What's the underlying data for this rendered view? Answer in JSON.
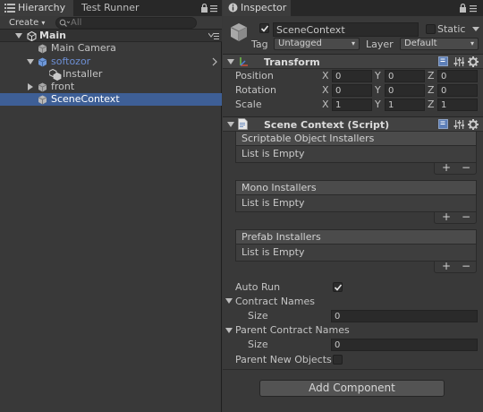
{
  "hierarchy": {
    "tabs": [
      {
        "label": "Hierarchy"
      },
      {
        "label": "Test Runner"
      }
    ],
    "toolbar": {
      "create_label": "Create",
      "search_placeholder": "All"
    },
    "scene": {
      "name": "Main"
    },
    "items": [
      {
        "label": "Main Camera",
        "icon": "cube-icon",
        "selected": false
      },
      {
        "label": "softozor",
        "icon": "prefab-cube-icon",
        "selected": false,
        "color": "#6d8fd4"
      },
      {
        "label": "Installer",
        "icon": "cube-stack-icon",
        "selected": false
      },
      {
        "label": "front",
        "icon": "cube-icon",
        "selected": false
      },
      {
        "label": "SceneContext",
        "icon": "cube-icon",
        "selected": true
      }
    ]
  },
  "inspector": {
    "tab": {
      "label": "Inspector"
    },
    "object": {
      "name": "SceneContext",
      "active": true,
      "static_label": "Static",
      "static_checked": false,
      "tag_label": "Tag",
      "tag_value": "Untagged",
      "layer_label": "Layer",
      "layer_value": "Default"
    },
    "transform": {
      "title": "Transform",
      "rows": [
        {
          "label": "Position",
          "x": "0",
          "y": "0",
          "z": "0"
        },
        {
          "label": "Rotation",
          "x": "0",
          "y": "0",
          "z": "0"
        },
        {
          "label": "Scale",
          "x": "1",
          "y": "1",
          "z": "1"
        }
      ],
      "axis": {
        "x": "X",
        "y": "Y",
        "z": "Z"
      }
    },
    "script": {
      "title": "Scene Context (Script)",
      "lists": [
        {
          "header": "Scriptable Object Installers",
          "body": "List is Empty"
        },
        {
          "header": "Mono Installers",
          "body": "List is Empty"
        },
        {
          "header": "Prefab Installers",
          "body": "List is Empty"
        }
      ],
      "plus": "+",
      "minus": "−",
      "auto_run": {
        "label": "Auto Run",
        "checked": true
      },
      "contract_names": {
        "label": "Contract Names",
        "size_label": "Size",
        "size_value": "0"
      },
      "parent_contract_names": {
        "label": "Parent Contract Names",
        "size_label": "Size",
        "size_value": "0"
      },
      "parent_new_objects": {
        "label": "Parent New Objects U",
        "checked": false
      }
    },
    "add_component": "Add Component"
  },
  "colors": {
    "selection": "#3e5f96",
    "prefab_text": "#6d8fd4",
    "background": "#393939"
  }
}
